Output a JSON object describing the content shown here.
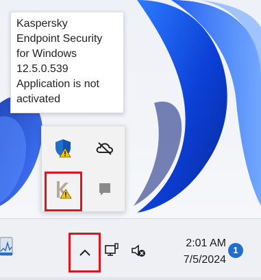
{
  "tooltip": {
    "lines": [
      "Kaspersky",
      "Endpoint Security",
      "for Windows",
      "12.5.0.539",
      "Application is not",
      "activated"
    ]
  },
  "flyout": {
    "icons": [
      {
        "name": "windows-security-warning-icon",
        "color": "#1f6fd1"
      },
      {
        "name": "onedrive-offline-icon",
        "color": "#222222"
      },
      {
        "name": "kaspersky-warning-icon",
        "color": "#b6a99a"
      },
      {
        "name": "tray-app-icon",
        "color": "#777777"
      }
    ]
  },
  "taskbar": {
    "time": "2:01 AM",
    "date": "7/5/2024",
    "notification_count": "1",
    "accent": "#1f6fd1"
  },
  "highlight_color": "#e0141e"
}
